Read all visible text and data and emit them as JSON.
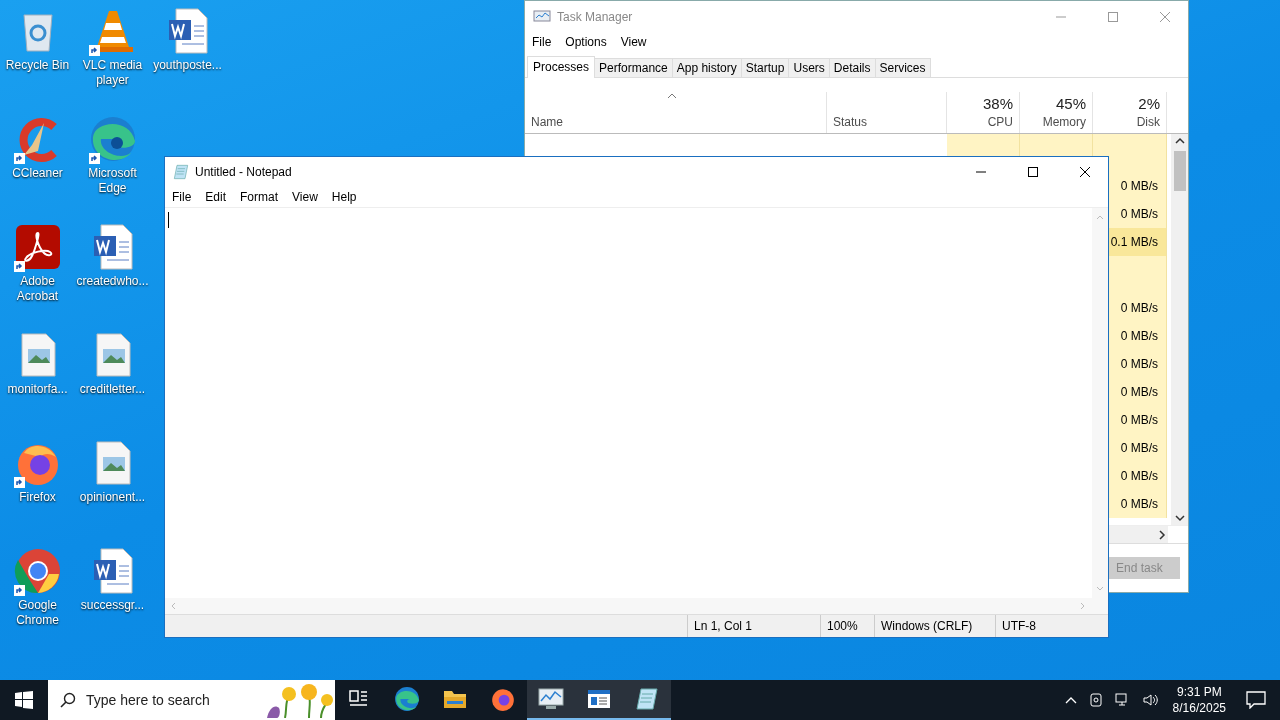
{
  "desktop_icons": [
    {
      "label": "Recycle Bin",
      "kind": "recycle-bin",
      "shortcut": false
    },
    {
      "label": "CCleaner",
      "kind": "ccleaner",
      "shortcut": true
    },
    {
      "label": "Adobe Acrobat",
      "kind": "acrobat",
      "shortcut": true
    },
    {
      "label": "monitorfa...",
      "kind": "image",
      "shortcut": false
    },
    {
      "label": "Firefox",
      "kind": "firefox",
      "shortcut": true
    },
    {
      "label": "Google Chrome",
      "kind": "chrome",
      "shortcut": true
    },
    {
      "label": "VLC media player",
      "kind": "vlc",
      "shortcut": true
    },
    {
      "label": "Microsoft Edge",
      "kind": "edge",
      "shortcut": true
    },
    {
      "label": "createdwho...",
      "kind": "word",
      "shortcut": false
    },
    {
      "label": "creditletter...",
      "kind": "image",
      "shortcut": false
    },
    {
      "label": "opinionent...",
      "kind": "image",
      "shortcut": false
    },
    {
      "label": "successgr...",
      "kind": "word",
      "shortcut": false
    },
    {
      "label": "youthposte...",
      "kind": "word",
      "shortcut": false
    }
  ],
  "task_manager": {
    "title": "Task Manager",
    "menu": [
      "File",
      "Options",
      "View"
    ],
    "tabs": [
      {
        "label": "Processes",
        "selected": true
      },
      {
        "label": "Performance",
        "selected": false
      },
      {
        "label": "App history",
        "selected": false
      },
      {
        "label": "Startup",
        "selected": false
      },
      {
        "label": "Users",
        "selected": false
      },
      {
        "label": "Details",
        "selected": false
      },
      {
        "label": "Services",
        "selected": false
      }
    ],
    "columns": [
      {
        "label": "Name"
      },
      {
        "label": "Status"
      },
      {
        "reading": "38%",
        "label": "CPU"
      },
      {
        "reading": "45%",
        "label": "Memory"
      },
      {
        "reading": "2%",
        "label": "Disk"
      }
    ],
    "rows": [
      {
        "kind": "group"
      },
      {
        "kind": "process",
        "disk": "0 MB/s",
        "highlighted": false
      },
      {
        "kind": "process",
        "disk": "0 MB/s",
        "highlighted": false
      },
      {
        "kind": "process",
        "disk": "0.1 MB/s",
        "highlighted": true
      },
      {
        "kind": "group"
      },
      {
        "kind": "process",
        "disk": "0 MB/s",
        "highlighted": false
      },
      {
        "kind": "process",
        "disk": "0 MB/s",
        "highlighted": false
      },
      {
        "kind": "process",
        "disk": "0 MB/s",
        "highlighted": false
      },
      {
        "kind": "process",
        "disk": "0 MB/s",
        "highlighted": false
      },
      {
        "kind": "process",
        "disk": "0 MB/s",
        "highlighted": false
      },
      {
        "kind": "process",
        "disk": "0 MB/s",
        "highlighted": false
      },
      {
        "kind": "process",
        "disk": "0 MB/s",
        "highlighted": false
      },
      {
        "kind": "process",
        "disk": "0 MB/s",
        "highlighted": false
      }
    ],
    "end_task": {
      "label": "End task",
      "disabled": true
    }
  },
  "notepad": {
    "title": "Untitled - Notepad",
    "menu": [
      "File",
      "Edit",
      "Format",
      "View",
      "Help"
    ],
    "status": [
      "Ln 1, Col 1",
      "100%",
      "Windows (CRLF)",
      "UTF-8"
    ]
  },
  "taskbar": {
    "search_placeholder": "Type here to search",
    "apps": [
      {
        "kind": "task-view",
        "active": false
      },
      {
        "kind": "edge",
        "active": false
      },
      {
        "kind": "folder",
        "active": false
      },
      {
        "kind": "firefox",
        "active": false
      },
      {
        "kind": "task-manager",
        "active": true
      },
      {
        "kind": "window",
        "active": true
      },
      {
        "kind": "notepad",
        "active": true
      }
    ],
    "time": "9:31 PM",
    "date": "8/16/2025"
  }
}
